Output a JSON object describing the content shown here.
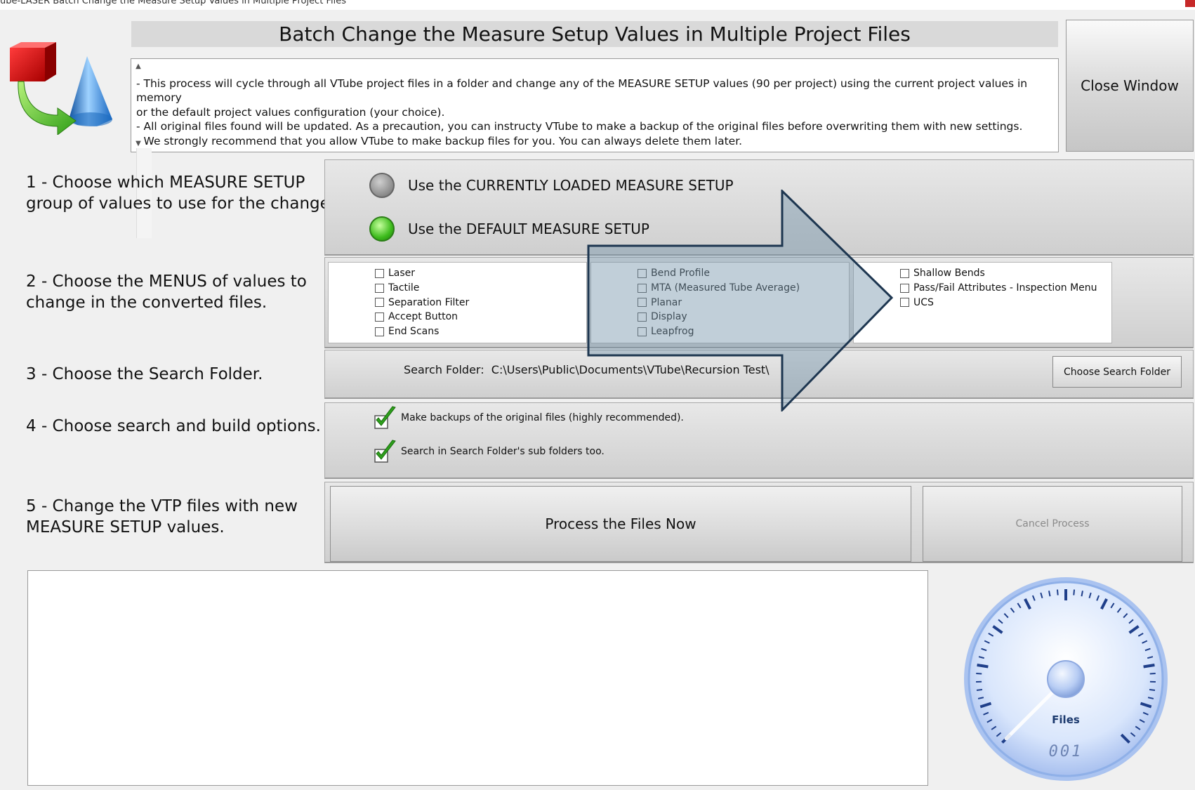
{
  "window": {
    "title": "ube-LASER Batch Change the Measure Setup Values in Multiple Project Files"
  },
  "header": {
    "title": "Batch Change the Measure Setup Values in Multiple Project Files",
    "description": "- This process will cycle through all VTube project files in a folder and change any of the MEASURE SETUP values (90 per project) using the current project values in memory\nor the default project values configuration (your choice).\n- All original files found will be updated. As a precaution, you can instructy VTube to make a backup of the original files before overwriting them with new settings.\n- We strongly recommend that you allow VTube to make backup files for you. You can always delete them later.",
    "close_label": "Close Window",
    "logo_icon": "cube-arrow-cone-icon"
  },
  "steps": [
    {
      "label": "1 - Choose which MEASURE SETUP\ngroup of values to use for the change."
    },
    {
      "label": "2 - Choose the MENUS of values to\nchange in the converted files."
    },
    {
      "label": "3 - Choose the Search Folder."
    },
    {
      "label": "4 - Choose search and build options."
    },
    {
      "label": "5 - Change the VTP files with new\nMEASURE SETUP values."
    }
  ],
  "setup_choice": {
    "options": [
      {
        "label": "Use the CURRENTLY LOADED MEASURE SETUP",
        "selected": false
      },
      {
        "label": "Use the DEFAULT MEASURE SETUP",
        "selected": true
      }
    ]
  },
  "menus": {
    "columns": [
      {
        "items": [
          {
            "label": "Laser",
            "checked": false
          },
          {
            "label": "Tactile",
            "checked": false
          },
          {
            "label": "Separation Filter",
            "checked": false
          },
          {
            "label": "Accept Button",
            "checked": false
          },
          {
            "label": "End Scans",
            "checked": false
          }
        ]
      },
      {
        "items": [
          {
            "label": "Bend Profile",
            "checked": false
          },
          {
            "label": "MTA (Measured Tube Average)",
            "checked": false
          },
          {
            "label": "Planar",
            "checked": false
          },
          {
            "label": "Display",
            "checked": false
          },
          {
            "label": "Leapfrog",
            "checked": false
          }
        ]
      },
      {
        "items": [
          {
            "label": "Shallow Bends",
            "checked": false
          },
          {
            "label": "Pass/Fail Attributes - Inspection Menu",
            "checked": false
          },
          {
            "label": "UCS",
            "checked": false
          }
        ]
      }
    ]
  },
  "search": {
    "label": "Search Folder:  C:\\Users\\Public\\Documents\\VTube\\Recursion Test\\",
    "choose_button": "Choose Search Folder"
  },
  "options": [
    {
      "label": "Make backups of the original files (highly recommended).",
      "checked": true
    },
    {
      "label": "Search in Search Folder's sub folders too.",
      "checked": true
    }
  ],
  "actions": {
    "process_label": "Process the Files Now",
    "cancel_label": "Cancel Process"
  },
  "gauge": {
    "label": "Files",
    "value": "001",
    "level": 0.0
  },
  "colors": {
    "radio_on": "#3dbb1c",
    "arrow_fill": "#7594ab",
    "arrow_stroke": "#1d3650",
    "gauge_face": "#cfe0fb"
  }
}
